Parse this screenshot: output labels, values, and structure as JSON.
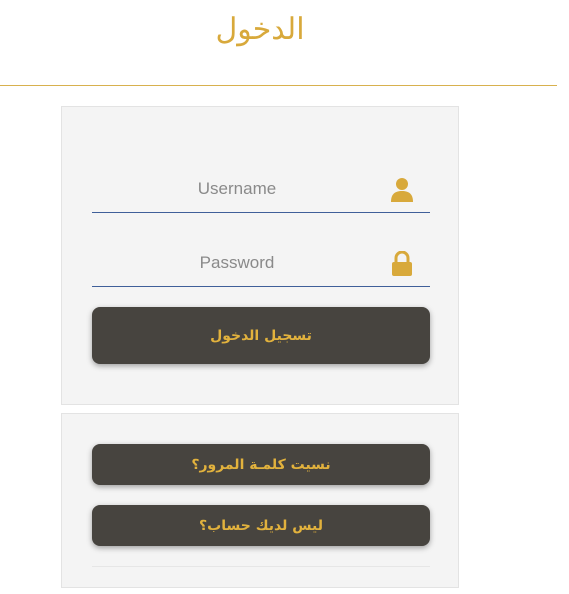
{
  "header": {
    "title": "الدخول"
  },
  "login_form": {
    "username": {
      "placeholder": "Username",
      "value": "",
      "icon": "user-icon"
    },
    "password": {
      "placeholder": "Password",
      "value": "",
      "icon": "lock-icon"
    },
    "submit_label": "تسجيل الدخول"
  },
  "links": {
    "forgot_password_label": "نسيت كلمـة المرور؟",
    "register_label": "ليس لديك حساب؟"
  },
  "colors": {
    "accent": "#d8a93b",
    "button_bg": "#47443f",
    "button_text": "#e2b23d",
    "field_underline": "#3f5f99",
    "panel_bg": "#f4f4f4"
  }
}
